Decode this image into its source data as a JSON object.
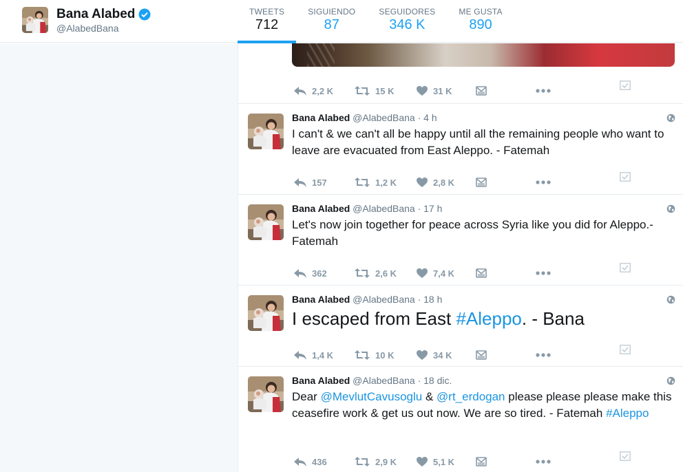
{
  "profile": {
    "name": "Bana Alabed",
    "handle": "@AlabedBana"
  },
  "stats": [
    {
      "label": "TWEETS",
      "value": "712"
    },
    {
      "label": "SIGUIENDO",
      "value": "87"
    },
    {
      "label": "SEGUIDORES",
      "value": "346 K"
    },
    {
      "label": "ME GUSTA",
      "value": "890"
    }
  ],
  "first_tweet_actions": {
    "replies": "2,2 K",
    "retweets": "15 K",
    "likes": "31 K"
  },
  "tweets": [
    {
      "name": "Bana Alabed",
      "handle": "@AlabedBana",
      "dot": "·",
      "time": "4 h",
      "text": "I can't & we can't all be happy until all the remaining people who want to leave are evacuated from East Aleppo. - Fatemah",
      "replies": "157",
      "retweets": "1,2 K",
      "likes": "2,8 K"
    },
    {
      "name": "Bana Alabed",
      "handle": "@AlabedBana",
      "dot": "·",
      "time": "17 h",
      "text": "Let's now join together for peace across Syria like you did for Aleppo.- Fatemah",
      "replies": "362",
      "retweets": "2,6 K",
      "likes": "7,4 K"
    },
    {
      "name": "Bana Alabed",
      "handle": "@AlabedBana",
      "dot": "·",
      "time": "18 h",
      "text_before": "I escaped from East ",
      "hashtag": "#Aleppo",
      "text_after": ". - Bana",
      "replies": "1,4 K",
      "retweets": "10 K",
      "likes": "34 K"
    },
    {
      "name": "Bana Alabed",
      "handle": "@AlabedBana",
      "dot": "·",
      "time": "18 dic.",
      "text_1": "Dear ",
      "mention_1": "@MevlutCavusoglu",
      "text_2": " & ",
      "mention_2": "@rt_erdogan",
      "text_3": " please please please make this ceasefire work & get us out now. We are so tired. - Fatemah ",
      "hashtag": "#Aleppo",
      "replies": "436",
      "retweets": "2,9 K",
      "likes": "5,1 K"
    }
  ],
  "colors": {
    "accent": "#1da1f2",
    "link": "#1b95e0",
    "muted": "#657786",
    "action": "#8899a6"
  }
}
